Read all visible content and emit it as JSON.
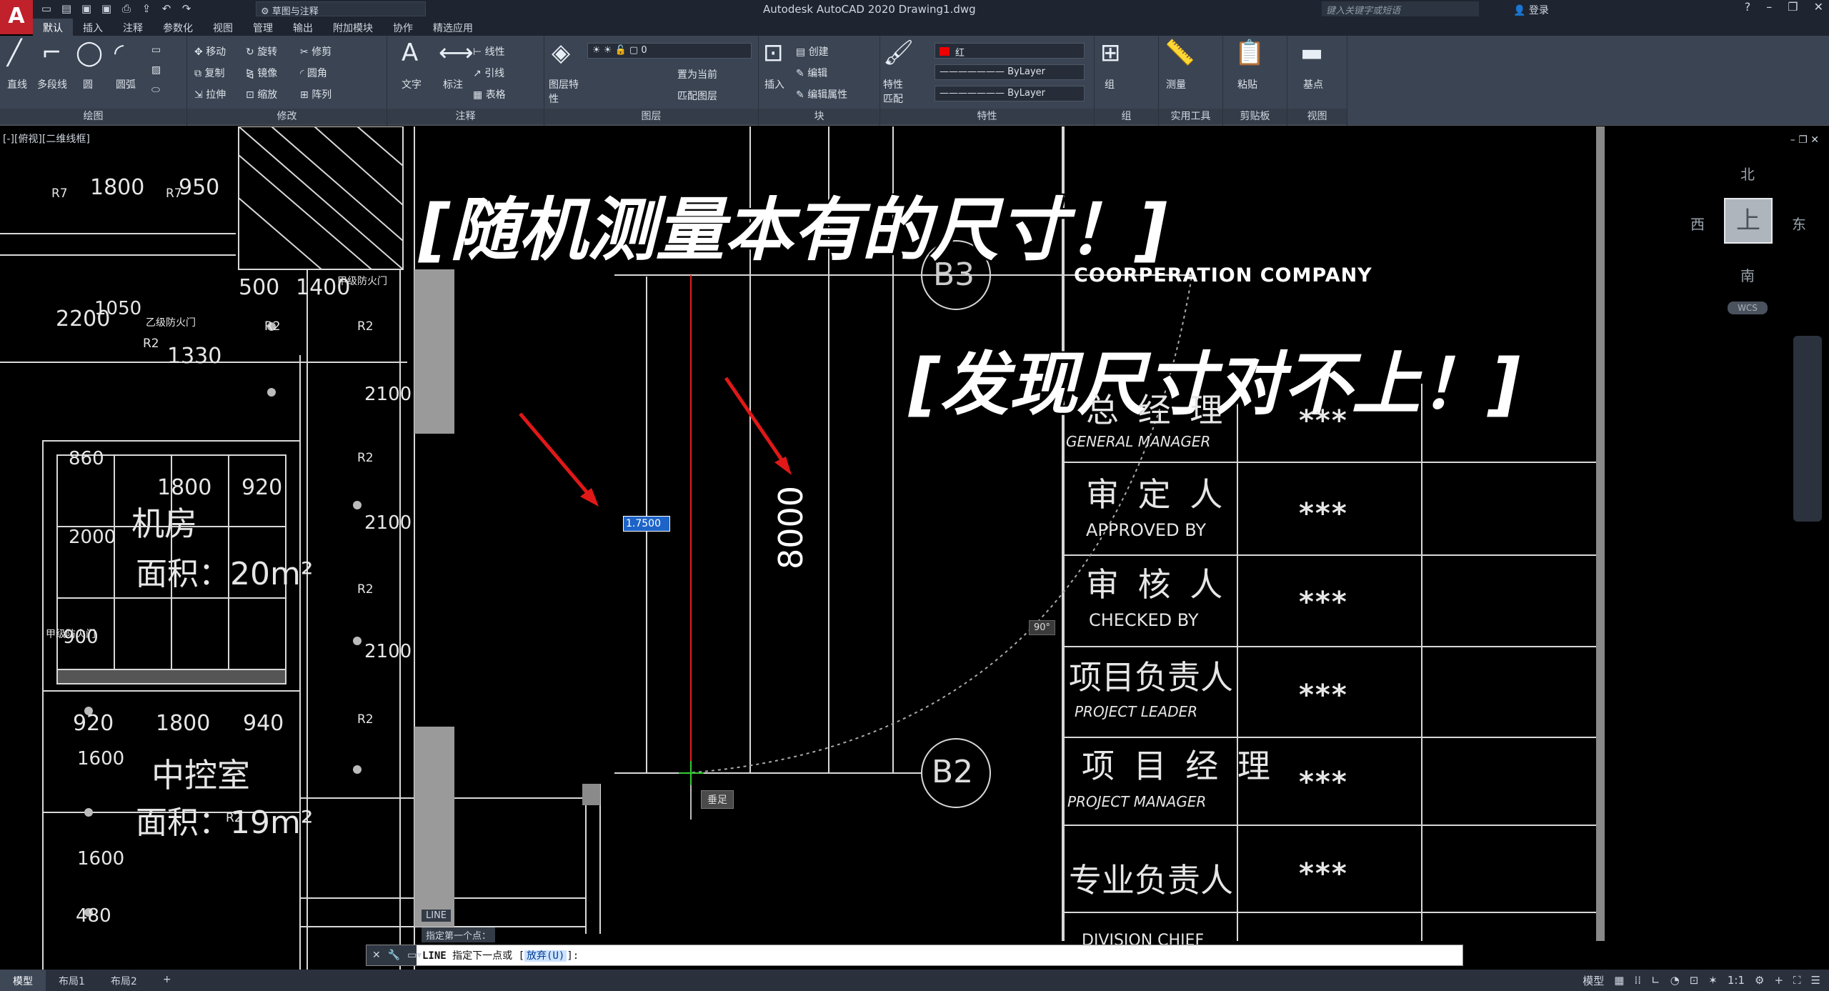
{
  "titlebar": {
    "logo": "A",
    "workspace": "草图与注释",
    "app_title": "Autodesk AutoCAD 2020    Drawing1.dwg",
    "search_placeholder": "键入关键字或短语",
    "login": "登录"
  },
  "tabs": [
    "默认",
    "插入",
    "注释",
    "参数化",
    "视图",
    "管理",
    "输出",
    "附加模块",
    "协作",
    "精选应用"
  ],
  "ribbon": {
    "draw": {
      "title": "绘图",
      "line": "直线",
      "polyline": "多段线",
      "circle": "圆",
      "arc": "圆弧"
    },
    "modify": {
      "title": "修改",
      "move": "移动",
      "rotate": "旋转",
      "trim": "修剪",
      "copy": "复制",
      "mirror": "镜像",
      "fillet": "圆角",
      "stretch": "拉伸",
      "scale": "缩放",
      "array": "阵列"
    },
    "annotation": {
      "title": "注释",
      "text": "文字",
      "dimension": "标注",
      "linear": "线性",
      "leader": "引线",
      "table": "表格"
    },
    "layers": {
      "title": "图层",
      "properties": "图层特性",
      "current_layer": "0",
      "make_current": "置为当前",
      "match_layer": "匹配图层"
    },
    "block": {
      "title": "块",
      "insert": "插入",
      "create": "创建",
      "edit": "编辑",
      "edit_attr": "编辑属性"
    },
    "properties": {
      "title": "特性",
      "match": "特性匹配",
      "color": "红",
      "linetype": "ByLayer",
      "lineweight": "ByLayer"
    },
    "groups": {
      "title": "组",
      "group": "组"
    },
    "utilities": {
      "title": "实用工具",
      "measure": "测量"
    },
    "clipboard": {
      "title": "剪贴板",
      "paste": "粘贴"
    },
    "view": {
      "title": "视图",
      "base": "基点"
    }
  },
  "canvas": {
    "view_label": "[-][俯视][二维线框]",
    "company": "COORPERATION COMPANY",
    "caption1": "[随机测量本有的尺寸！]",
    "caption2": "[发现尺寸对不上！]",
    "dim_8000": "8000",
    "dyn_input": "1.7500",
    "angle_tip": "90°",
    "perp_tip": "垂足",
    "grid_b3": "B3",
    "grid_b2": "B2",
    "room1": "机房",
    "room1_area": "面积：20m²",
    "room2": "中控室",
    "room2_area": "面积：19m²",
    "dims": [
      "1800",
      "950",
      "500",
      "1400",
      "2200",
      "1050",
      "1330",
      "2100",
      "1800",
      "920",
      "2100",
      "900",
      "2100",
      "920",
      "1800",
      "940",
      "1600",
      "1600",
      "480",
      "860",
      "2000"
    ],
    "labels": [
      "R7",
      "R7",
      "R2",
      "R2",
      "R2",
      "R2",
      "R2",
      "R2",
      "R2",
      "甲级防火门",
      "乙级防火门",
      "甲级防火门"
    ],
    "history1": "LINE",
    "history2": "指定第一个点："
  },
  "titleblock": {
    "rows": [
      {
        "cn": "总 经 理",
        "en": "GENERAL MANAGER",
        "val": "***"
      },
      {
        "cn": "审 定 人",
        "en": "APPROVED BY",
        "val": "***"
      },
      {
        "cn": "审 核 人",
        "en": "CHECKED BY",
        "val": "***"
      },
      {
        "cn": "项目负责人",
        "en": "PROJECT LEADER",
        "val": "***"
      },
      {
        "cn": "项 目 经 理",
        "en": "PROJECT MANAGER",
        "val": "***"
      },
      {
        "cn": "专业负责人",
        "en": "DIVISION CHIEF",
        "val": "***"
      }
    ]
  },
  "viewcube": {
    "north": "北",
    "south": "南",
    "east": "东",
    "west": "西",
    "top": "上",
    "wcs": "WCS"
  },
  "commandline": {
    "cmd": "LINE",
    "prompt": "指定下一点或 [",
    "option": "放弃(U)",
    "suffix": "]:"
  },
  "layout_tabs": [
    "模型",
    "布局1",
    "布局2",
    "+"
  ],
  "status": {
    "model": "模型",
    "scale": "1:1"
  }
}
